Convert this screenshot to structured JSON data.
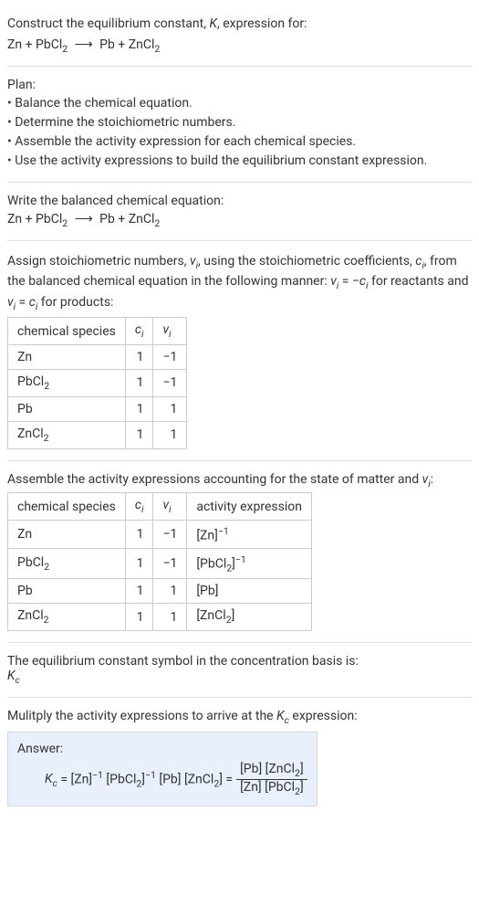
{
  "prompt_line1": "Construct the equilibrium constant, K, expression for:",
  "equation": "Zn + PbCl₂ ⟶ Pb + ZnCl₂",
  "plan_heading": "Plan:",
  "plan_items": [
    "• Balance the chemical equation.",
    "• Determine the stoichiometric numbers.",
    "• Assemble the activity expression for each chemical species.",
    "• Use the activity expressions to build the equilibrium constant expression."
  ],
  "balanced_heading": "Write the balanced chemical equation:",
  "assign_text_1": "Assign stoichiometric numbers, νᵢ, using the stoichiometric coefficients, cᵢ, from the balanced chemical equation in the following manner: νᵢ = −cᵢ for reactants and νᵢ = cᵢ for products:",
  "table1": {
    "headers": [
      "chemical species",
      "cᵢ",
      "νᵢ"
    ],
    "rows": [
      [
        "Zn",
        "1",
        "−1"
      ],
      [
        "PbCl₂",
        "1",
        "−1"
      ],
      [
        "Pb",
        "1",
        "1"
      ],
      [
        "ZnCl₂",
        "1",
        "1"
      ]
    ]
  },
  "assemble_text": "Assemble the activity expressions accounting for the state of matter and νᵢ:",
  "table2": {
    "headers": [
      "chemical species",
      "cᵢ",
      "νᵢ",
      "activity expression"
    ],
    "rows": [
      {
        "species": "Zn",
        "ci": "1",
        "vi": "−1",
        "expr": "[Zn]⁻¹"
      },
      {
        "species": "PbCl₂",
        "ci": "1",
        "vi": "−1",
        "expr": "[PbCl₂]⁻¹"
      },
      {
        "species": "Pb",
        "ci": "1",
        "vi": "1",
        "expr": "[Pb]"
      },
      {
        "species": "ZnCl₂",
        "ci": "1",
        "vi": "1",
        "expr": "[ZnCl₂]"
      }
    ]
  },
  "kc_symbol_text": "The equilibrium constant symbol in the concentration basis is:",
  "kc_symbol": "K꜀",
  "multiply_text": "Mulitply the activity expressions to arrive at the K꜀ expression:",
  "answer_label": "Answer:",
  "answer_expr": {
    "lhs": "K꜀ = [Zn]⁻¹ [PbCl₂]⁻¹ [Pb] [ZnCl₂] =",
    "numerator": "[Pb] [ZnCl₂]",
    "denominator": "[Zn] [PbCl₂]"
  }
}
